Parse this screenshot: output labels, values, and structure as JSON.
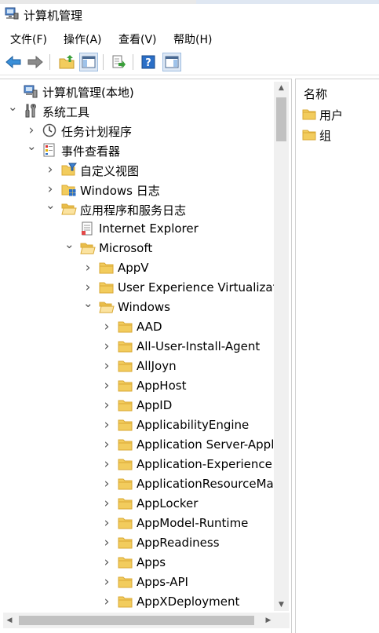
{
  "window": {
    "title": "计算机管理"
  },
  "menu": [
    {
      "label": "文件(F)"
    },
    {
      "label": "操作(A)"
    },
    {
      "label": "查看(V)"
    },
    {
      "label": "帮助(H)"
    }
  ],
  "toolbar": {
    "buttons": [
      "back-arrow-icon",
      "forward-arrow-icon",
      "up-folder-icon",
      "show-hide-tree-icon",
      "export-list-icon",
      "help-icon",
      "show-hide-action-pane-icon"
    ]
  },
  "tree": {
    "rows": [
      {
        "label": "计算机管理(本地)",
        "icon": "computer-management-icon",
        "chevron": "none"
      },
      {
        "label": "系统工具",
        "icon": "tools-icon",
        "chevron": "open"
      },
      {
        "label": "任务计划程序",
        "icon": "clock-icon",
        "chevron": "closed"
      },
      {
        "label": "事件查看器",
        "icon": "event-viewer-icon",
        "chevron": "open"
      },
      {
        "label": "自定义视图",
        "icon": "folder-filter-icon",
        "chevron": "closed"
      },
      {
        "label": "Windows 日志",
        "icon": "folder-windows-icon",
        "chevron": "closed"
      },
      {
        "label": "应用程序和服务日志",
        "icon": "folder-open-icon",
        "chevron": "open"
      },
      {
        "label": "Internet Explorer",
        "icon": "log-icon",
        "chevron": "none"
      },
      {
        "label": "Microsoft",
        "icon": "folder-open-icon",
        "chevron": "open"
      },
      {
        "label": "AppV",
        "icon": "folder-icon",
        "chevron": "closed"
      },
      {
        "label": "User Experience Virtualizati",
        "icon": "folder-icon",
        "chevron": "closed"
      },
      {
        "label": "Windows",
        "icon": "folder-open-icon",
        "chevron": "open"
      },
      {
        "label": "AAD",
        "icon": "folder-icon",
        "chevron": "closed"
      },
      {
        "label": "All-User-Install-Agent",
        "icon": "folder-icon",
        "chevron": "closed"
      },
      {
        "label": "AllJoyn",
        "icon": "folder-icon",
        "chevron": "closed"
      },
      {
        "label": "AppHost",
        "icon": "folder-icon",
        "chevron": "closed"
      },
      {
        "label": "AppID",
        "icon": "folder-icon",
        "chevron": "closed"
      },
      {
        "label": "ApplicabilityEngine",
        "icon": "folder-icon",
        "chevron": "closed"
      },
      {
        "label": "Application Server-Appl",
        "icon": "folder-icon",
        "chevron": "closed"
      },
      {
        "label": "Application-Experience",
        "icon": "folder-icon",
        "chevron": "closed"
      },
      {
        "label": "ApplicationResourceMa",
        "icon": "folder-icon",
        "chevron": "closed"
      },
      {
        "label": "AppLocker",
        "icon": "folder-icon",
        "chevron": "closed"
      },
      {
        "label": "AppModel-Runtime",
        "icon": "folder-icon",
        "chevron": "closed"
      },
      {
        "label": "AppReadiness",
        "icon": "folder-icon",
        "chevron": "closed"
      },
      {
        "label": "Apps",
        "icon": "folder-icon",
        "chevron": "closed"
      },
      {
        "label": "Apps-API",
        "icon": "folder-icon",
        "chevron": "closed"
      },
      {
        "label": "AppXDeployment",
        "icon": "folder-icon",
        "chevron": "closed"
      }
    ]
  },
  "list": {
    "header": "名称",
    "items": [
      {
        "label": "用户",
        "icon": "folder-icon"
      },
      {
        "label": "组",
        "icon": "folder-icon"
      }
    ]
  },
  "colors": {
    "folder": "#f2cc5d",
    "folder_edge": "#d9a935",
    "toolbar_blue": "#2b6fc7"
  }
}
